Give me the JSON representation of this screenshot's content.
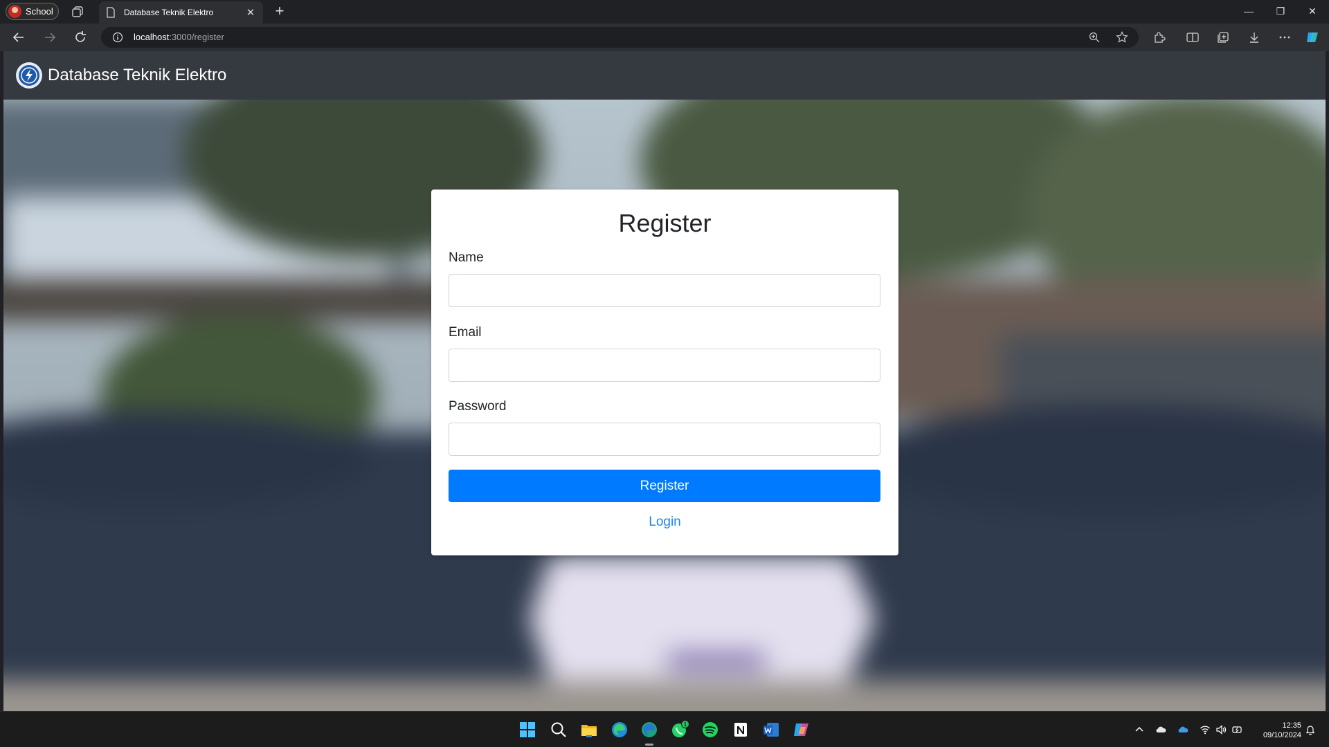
{
  "browser": {
    "profile_label": "School",
    "tab_title": "Database Teknik Elektro",
    "tab_close": "✕",
    "new_tab": "+",
    "url_host": "localhost",
    "url_path": ":3000/register",
    "window_controls": {
      "minimize": "—",
      "restore": "❐",
      "close": "✕"
    }
  },
  "navbar": {
    "brand": "Database Teknik Elektro"
  },
  "form": {
    "title": "Register",
    "fields": [
      {
        "label": "Name",
        "value": ""
      },
      {
        "label": "Email",
        "value": ""
      },
      {
        "label": "Password",
        "value": ""
      }
    ],
    "submit_label": "Register",
    "login_link": "Login"
  },
  "taskbar": {
    "whatsapp_badge": "1",
    "time": "12:35",
    "date": "09/10/2024"
  },
  "colors": {
    "navbar_bg": "#343a40",
    "primary": "#007bff",
    "link": "#1a84f0"
  },
  "icons": [
    "start-icon",
    "search-icon",
    "file-explorer-icon",
    "edge-icon",
    "edge-dev-icon",
    "whatsapp-icon",
    "spotify-icon",
    "notion-icon",
    "word-icon",
    "copilot-icon"
  ]
}
